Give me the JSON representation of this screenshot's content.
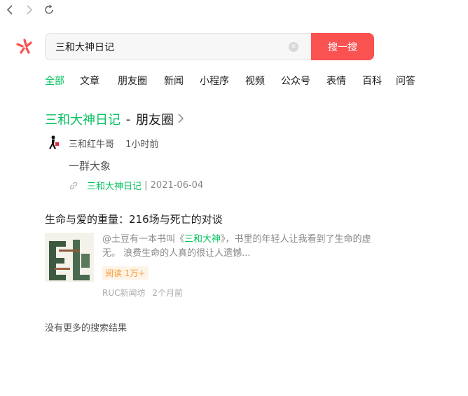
{
  "browser": {
    "back_icon": "chevron-left-icon",
    "forward_icon": "chevron-right-icon",
    "refresh_icon": "refresh-icon"
  },
  "search": {
    "query": "三和大神日记",
    "button_label": "搜一搜"
  },
  "tabs": [
    "全部",
    "文章",
    "朋友圈",
    "新闻",
    "小程序",
    "视频",
    "公众号",
    "表情",
    "百科",
    "问答"
  ],
  "active_tab": "全部",
  "moments": {
    "title_keyword": "三和大神日记",
    "title_sep": " - ",
    "title_suffix": "朋友圈",
    "author": "三和红牛哥",
    "time": "1小时前",
    "content": "一群大象",
    "link_keyword": "三和大神日记",
    "link_date": " | 2021-06-04"
  },
  "article": {
    "title": "生命与爱的重量：216场与死亡的对谈",
    "snippet_pre": "@土豆有一本书叫《",
    "snippet_kw": "三和大神",
    "snippet_post": "》，书里的年轻人让我看到了生命的虚无。 浪费生命的人真的很让人遗憾...",
    "reads": "阅读 1万+",
    "source": "RUC新闻坊",
    "time": "2个月前"
  },
  "end_text": "没有更多的搜索结果",
  "colors": {
    "accent": "#07c160",
    "button": "#fa5151",
    "badge": "#fa9d3b"
  }
}
